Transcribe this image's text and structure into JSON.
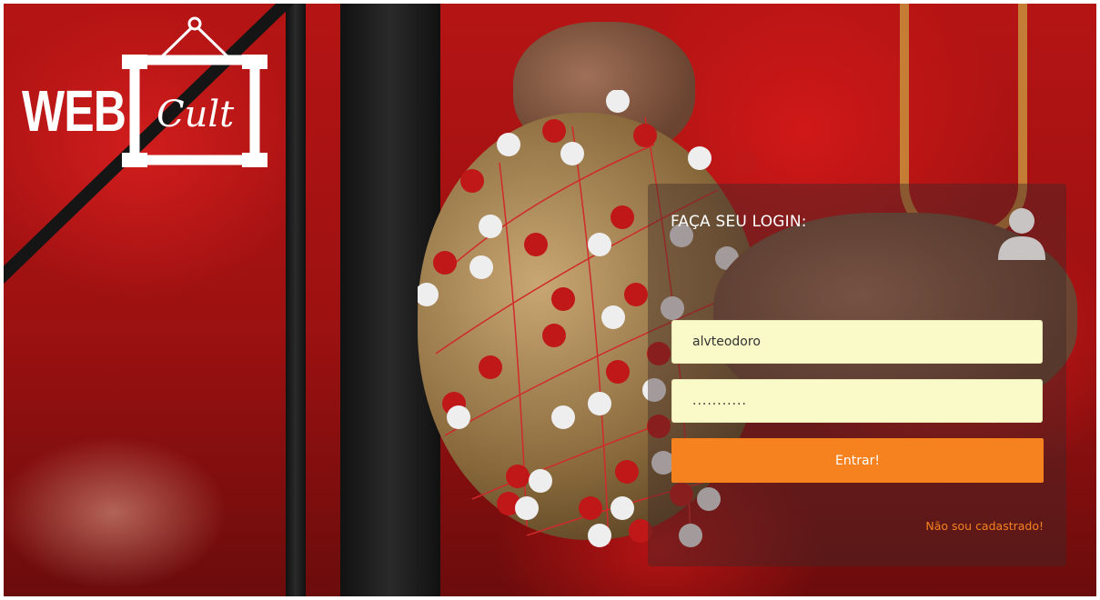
{
  "brand": {
    "logo_web": "WEB",
    "logo_cult": "Cult"
  },
  "login": {
    "title": "FAÇA SEU LOGIN:",
    "username_value": "alvteodoro",
    "password_value": "...........",
    "submit_label": "Entrar!",
    "register_link": "Não sou cadastrado!"
  },
  "colors": {
    "accent": "#f5821f",
    "input_background": "#fafac8",
    "card_background": "rgba(60,40,40,0.42)"
  },
  "icons": {
    "user": "user-avatar-icon"
  }
}
